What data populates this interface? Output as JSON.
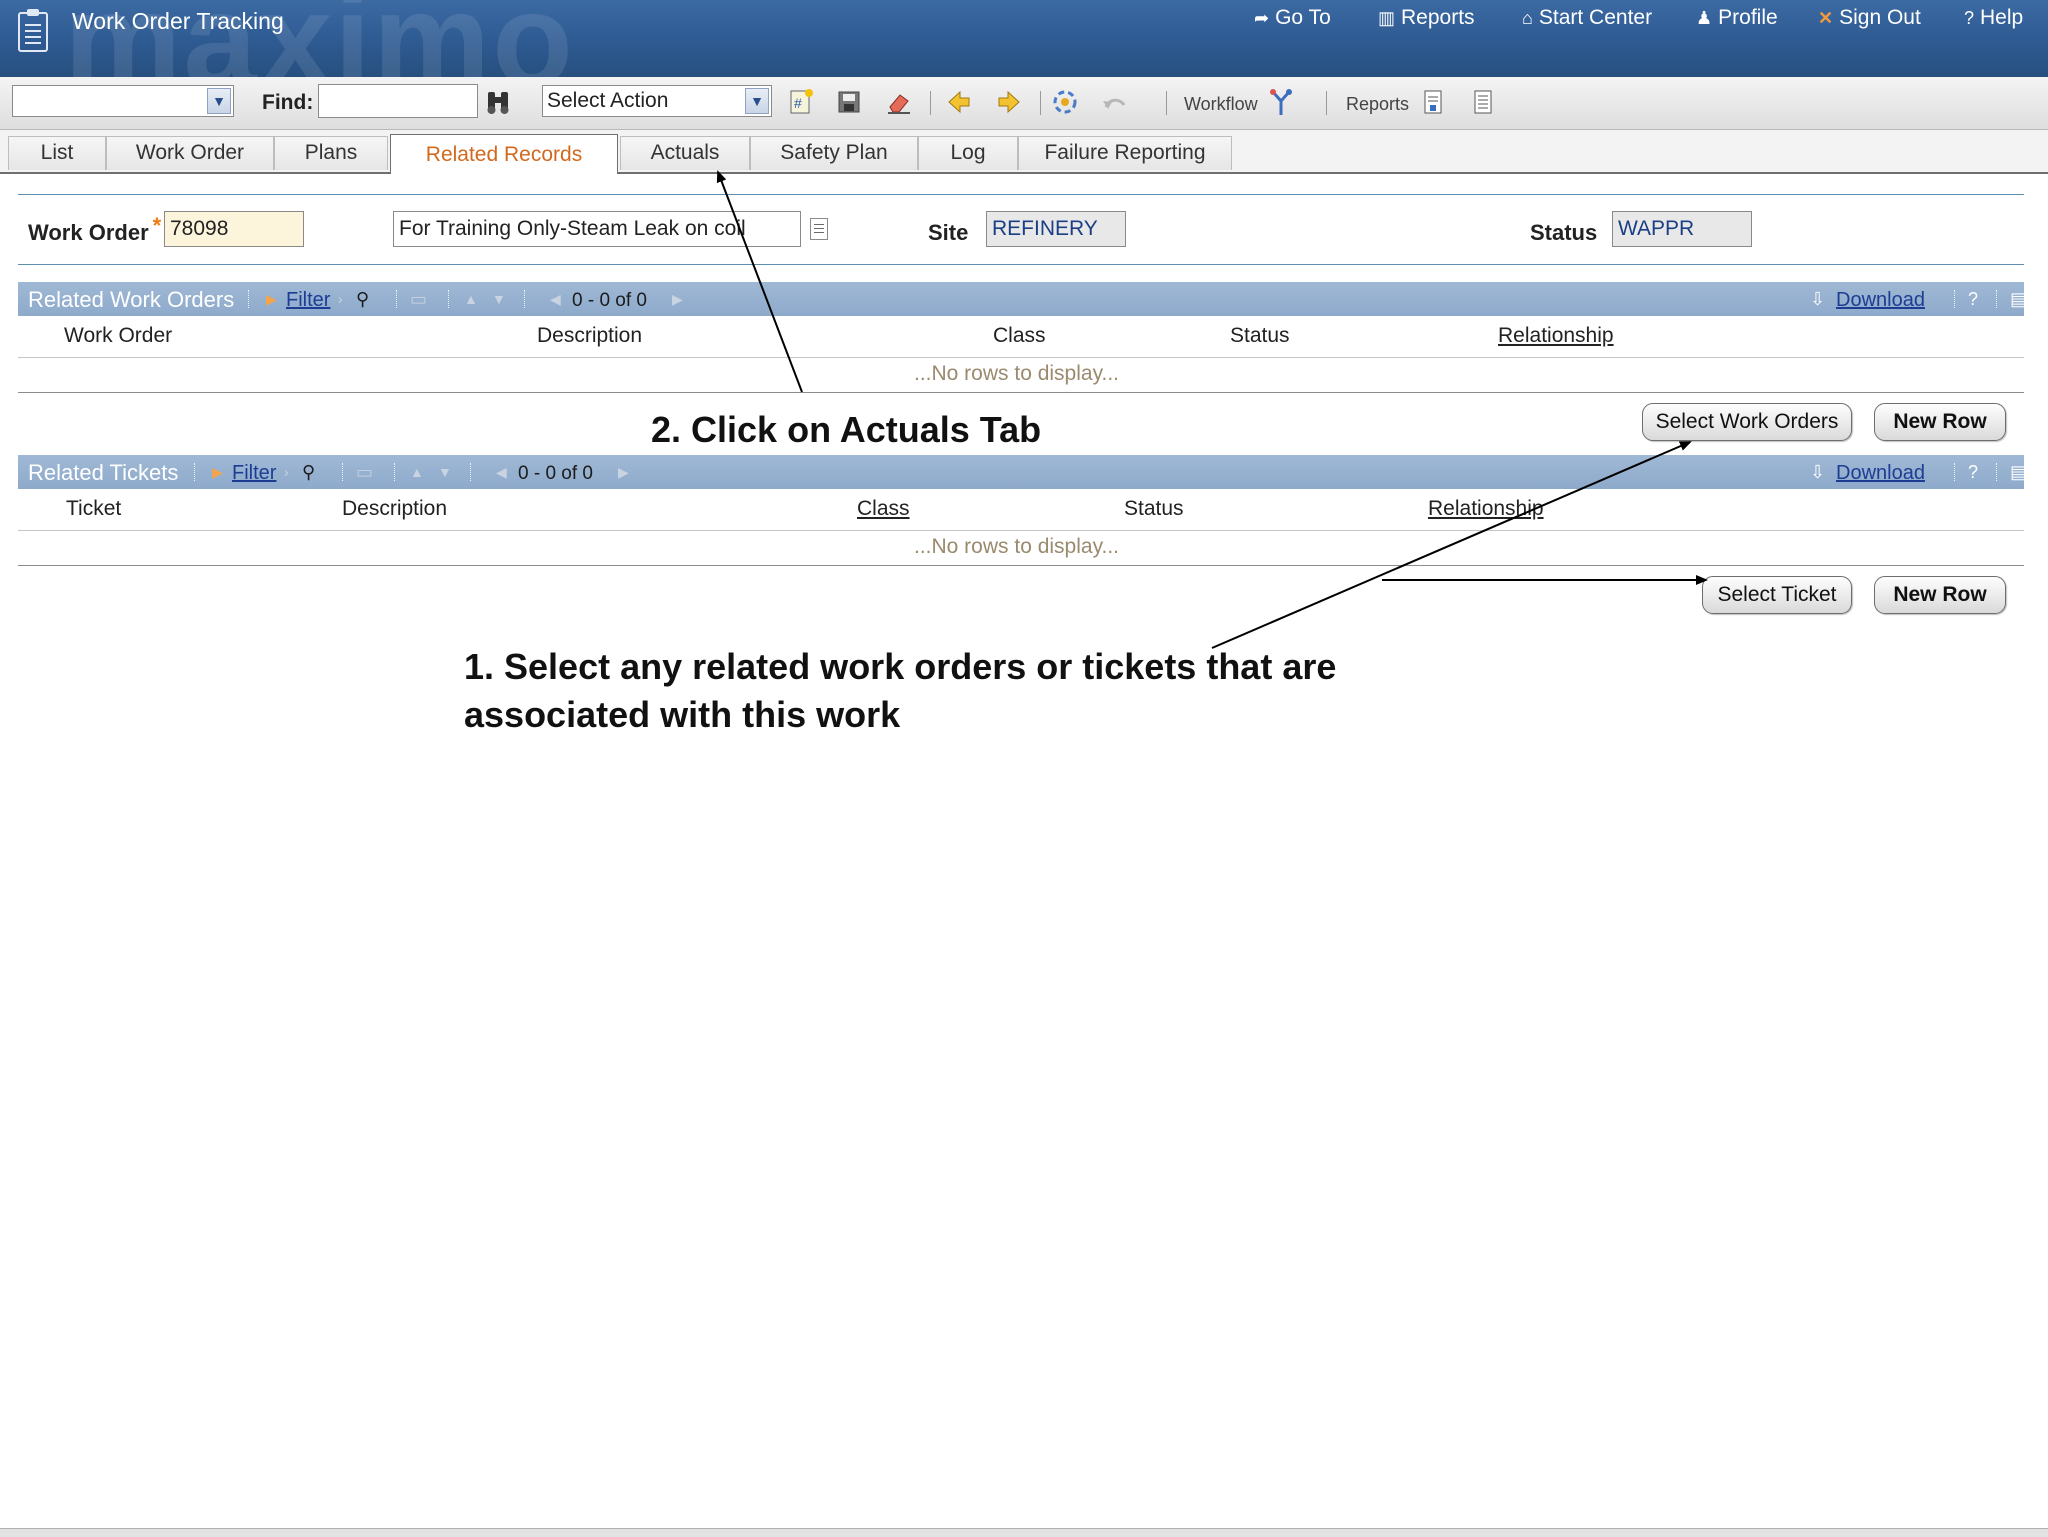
{
  "header": {
    "title": "Work Order Tracking",
    "watermark": "maximo",
    "nav": [
      {
        "label": "Go To",
        "icon": "go-to-icon"
      },
      {
        "label": "Reports",
        "icon": "reports-icon"
      },
      {
        "label": "Start Center",
        "icon": "home-icon"
      },
      {
        "label": "Profile",
        "icon": "profile-icon"
      },
      {
        "label": "Sign Out",
        "icon": "sign-out-icon"
      },
      {
        "label": "Help",
        "icon": "help-icon"
      }
    ]
  },
  "toolbar": {
    "query_value": "",
    "find_label": "Find:",
    "find_value": "",
    "select_action": "Select Action",
    "workflow_label": "Workflow",
    "reports_label": "Reports"
  },
  "tabs": [
    "List",
    "Work Order",
    "Plans",
    "Related Records",
    "Actuals",
    "Safety Plan",
    "Log",
    "Failure Reporting"
  ],
  "active_tab": "Related Records",
  "work_order": {
    "label": "Work Order",
    "required_mark": "*",
    "value": "78098",
    "description": "For Training Only-Steam Leak on coil",
    "site_label": "Site",
    "site_value": "REFINERY",
    "status_label": "Status",
    "status_value": "WAPPR"
  },
  "related_work_orders": {
    "title": "Related Work Orders",
    "filter_label": "Filter",
    "count": "0 - 0 of 0",
    "download_label": "Download",
    "help": "?",
    "columns": [
      "Work Order",
      "Description",
      "Class",
      "Status",
      "Relationship"
    ],
    "empty_text": "...No rows to display...",
    "select_button": "Select Work Orders",
    "new_row_button": "New Row"
  },
  "related_tickets": {
    "title": "Related Tickets",
    "filter_label": "Filter",
    "count": "0 - 0 of 0",
    "download_label": "Download",
    "help": "?",
    "columns": [
      "Ticket",
      "Description",
      "Class",
      "Status",
      "Relationship"
    ],
    "empty_text": "...No rows to display...",
    "select_button": "Select Ticket",
    "new_row_button": "New Row"
  },
  "annotations": {
    "step2": "2. Click on Actuals Tab",
    "step1_line1": "1. Select any related work orders or tickets that are",
    "step1_line2": "associated with this work"
  },
  "colors": {
    "header_blue": "#2e5a92",
    "section_blue": "#9fb8d5",
    "active_tab_text": "#d2691e",
    "required_star": "#ef7b11",
    "link_blue": "#1d3d94"
  }
}
